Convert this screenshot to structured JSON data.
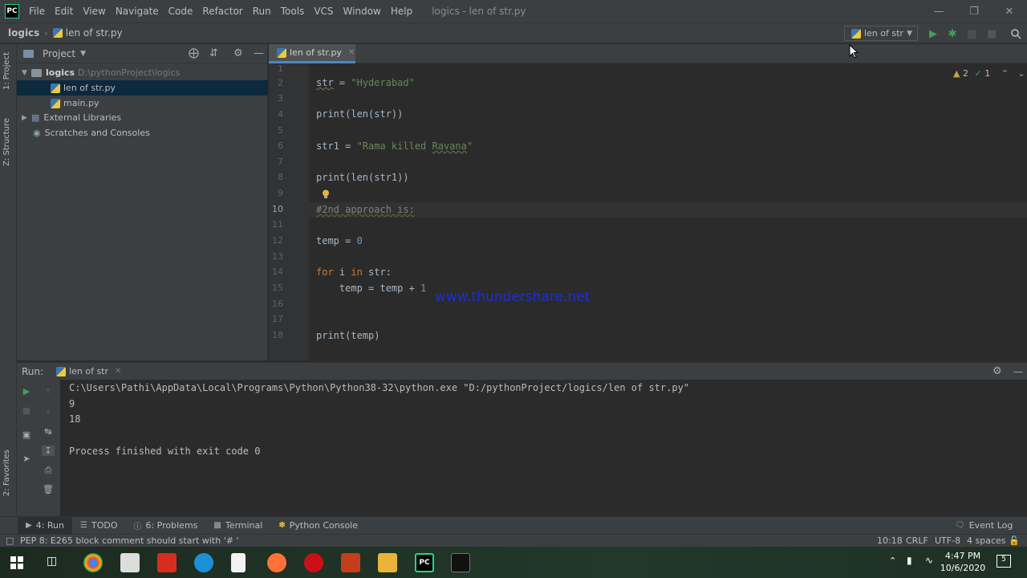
{
  "app": {
    "logo_text": "PC",
    "menu": [
      "File",
      "Edit",
      "View",
      "Navigate",
      "Code",
      "Refactor",
      "Run",
      "Tools",
      "VCS",
      "Window",
      "Help"
    ],
    "window_title": "logics - len of str.py"
  },
  "navbar": {
    "crumbs": [
      "logics",
      "len of str.py"
    ],
    "run_config": "len of str"
  },
  "left_strip": {
    "project_tab": "1: Project",
    "structure_tab": "Z: Structure",
    "favorites_tab": "2: Favorites"
  },
  "project": {
    "header": "Project",
    "tree": [
      {
        "label": "logics",
        "hint": "D:\\pythonProject\\logics"
      },
      {
        "label": "len of str.py"
      },
      {
        "label": "main.py"
      },
      {
        "label": "External Libraries"
      },
      {
        "label": "Scratches and Consoles"
      }
    ]
  },
  "editor": {
    "tab_label": "len of str.py",
    "line_numbers": [
      "1",
      "2",
      "3",
      "4",
      "5",
      "6",
      "7",
      "8",
      "9",
      "10",
      "11",
      "12",
      "13",
      "14",
      "15",
      "16",
      "17",
      "18"
    ],
    "current_line": "10",
    "lines": {
      "l2a": "str",
      "l2b": " = ",
      "l2c": "\"Hyderabad\"",
      "l4": "print(len(str))",
      "l6a": "str1 = ",
      "l6b": "\"Rama killed ",
      "l6c": "Ravana",
      "l6d": "\"",
      "l8": "print(len(str1))",
      "l10": "#2nd approach is:",
      "l12a": "temp = ",
      "l12b": "0",
      "l14a": "for",
      "l14b": " i ",
      "l14c": "in",
      "l14d": " str:",
      "l15a": "    temp = temp + ",
      "l15b": "1",
      "l18": "print(temp)"
    },
    "warnings": "2",
    "weak_warnings": "1",
    "watermark": "www.thundershare.net"
  },
  "run_panel": {
    "label": "Run:",
    "tab": "len of str",
    "output": [
      "C:\\Users\\Pathi\\AppData\\Local\\Programs\\Python\\Python38-32\\python.exe \"D:/pythonProject/logics/len of str.py\"",
      "9",
      "18",
      "",
      "Process finished with exit code 0"
    ]
  },
  "bottom_tabs": {
    "run": "4: Run",
    "todo": "TODO",
    "problems": "6: Problems",
    "terminal": "Terminal",
    "python_console": "Python Console",
    "event_log": "Event Log"
  },
  "status": {
    "message": "PEP 8: E265 block comment should start with '# '",
    "position": "10:18",
    "line_sep": "CRLF",
    "encoding": "UTF-8",
    "indent": "4 spaces"
  },
  "taskbar": {
    "time": "4:47 PM",
    "date": "10/6/2020",
    "notifications": "5"
  },
  "colors": {
    "accent": "#4a88c7",
    "run_green": "#499c54",
    "string": "#6a8759",
    "keyword": "#cc7832",
    "number": "#6897bb"
  }
}
